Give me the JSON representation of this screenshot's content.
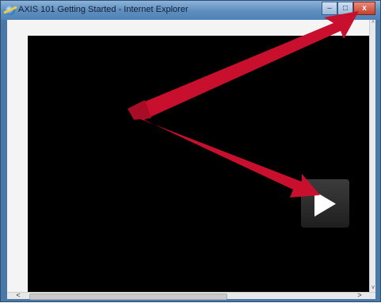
{
  "window": {
    "title": "AXIS 101 Getting Started - Internet Explorer",
    "icon": "internet-explorer-icon",
    "controls": {
      "minimize": "–",
      "maximize": "□",
      "close": "x"
    }
  },
  "video": {
    "play_icon": "play-icon"
  },
  "annotation": {
    "arrow_color": "#c8102e",
    "arrow_icon": "red-arrow"
  },
  "scrollbars": {
    "left_arrow": "<",
    "right_arrow": ">",
    "up_arrow": "^",
    "down_arrow": "v"
  }
}
